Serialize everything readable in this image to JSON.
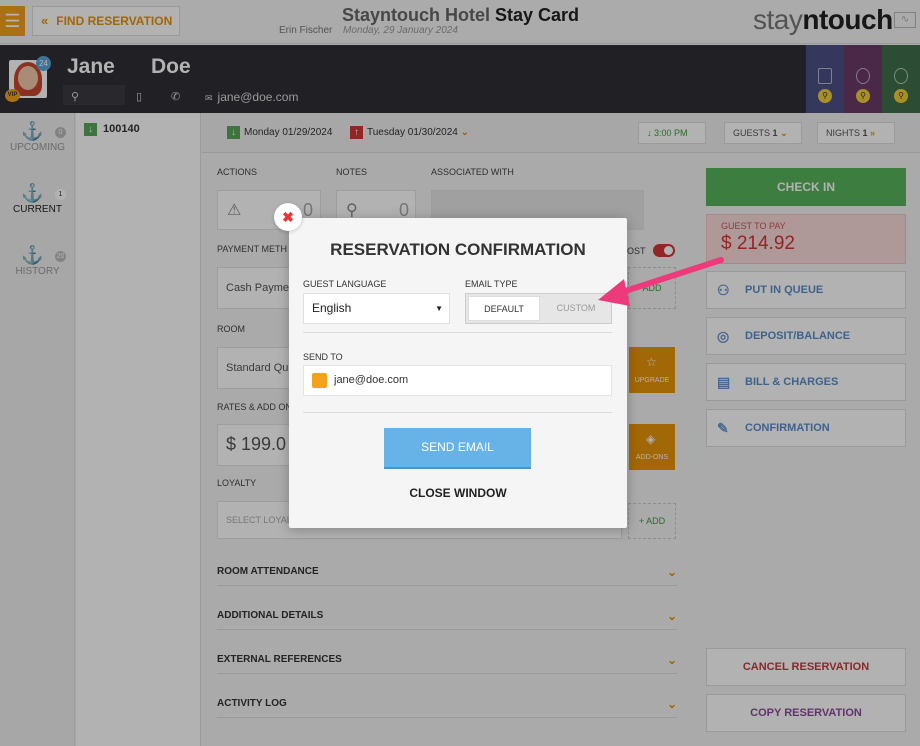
{
  "topbar": {
    "find_reservation": "FIND RESERVATION",
    "hotel_name": "Stayntouch Hotel",
    "page_title": "Stay Card",
    "user_name": "Erin Fischer",
    "business_date": "Monday, 29 January 2024",
    "logo_part1": "stay",
    "logo_part2": "n",
    "logo_part3": "touch"
  },
  "guest": {
    "first_name": "Jane",
    "last_name": "Doe",
    "email": "jane@doe.com",
    "avatar_badge": "24",
    "vip_label": "VIP",
    "tiles": [
      {
        "color": "#4c4f86"
      },
      {
        "color": "#693a68"
      },
      {
        "color": "#3f6f4a"
      }
    ]
  },
  "sidebar": {
    "items": [
      {
        "label": "UPCOMING",
        "count": "0"
      },
      {
        "label": "CURRENT",
        "count": "1"
      },
      {
        "label": "HISTORY",
        "count": "20"
      }
    ]
  },
  "reservation": {
    "number": "100140"
  },
  "staybar": {
    "arrival": "Monday 01/29/2024",
    "departure": "Tuesday 01/30/2024",
    "time": "3:00 PM",
    "guests_label": "GUESTS",
    "guests_value": "1",
    "nights_label": "NIGHTS",
    "nights_value": "1"
  },
  "main": {
    "actions_label": "ACTIONS",
    "actions_count": "0",
    "notes_label": "NOTES",
    "notes_count": "0",
    "associated_label": "ASSOCIATED WITH",
    "payment_label": "PAYMENT METH",
    "payment_value": "Cash Payme",
    "post_label": "OST",
    "add_label": "ADD",
    "room_label": "ROOM",
    "room_value": "Standard Qu",
    "upgrade_label": "UPGRADE",
    "rates_label": "RATES & ADD ON",
    "rate_value": "$ 199.0",
    "addons_label": "ADD-ONS",
    "loyalty_label": "LOYALTY",
    "loyalty_placeholder": "SELECT LOYAL",
    "loyalty_add": "+ ADD",
    "sections": [
      "ROOM ATTENDANCE",
      "ADDITIONAL DETAILS",
      "EXTERNAL REFERENCES",
      "ACTIVITY LOG"
    ]
  },
  "right": {
    "check_in": "CHECK IN",
    "guest_to_pay_label": "GUEST TO PAY",
    "guest_to_pay_amount": "$ 214.92",
    "buttons": [
      "PUT IN QUEUE",
      "DEPOSIT/BALANCE",
      "BILL & CHARGES",
      "CONFIRMATION"
    ],
    "cancel": "CANCEL RESERVATION",
    "copy": "COPY RESERVATION",
    "cancel_color": "#c33b3b",
    "copy_color": "#8b4a9c"
  },
  "modal": {
    "title": "RESERVATION CONFIRMATION",
    "guest_language_label": "GUEST LANGUAGE",
    "guest_language_value": "English",
    "email_type_label": "EMAIL TYPE",
    "email_type_options": [
      "DEFAULT",
      "CUSTOM"
    ],
    "email_type_selected": "DEFAULT",
    "send_to_label": "SEND TO",
    "send_to_value": "jane@doe.com",
    "send_email": "SEND EMAIL",
    "close_window": "CLOSE WINDOW",
    "close_icon": "close-icon"
  },
  "annotation": {
    "arrow_color": "#ee3a7a"
  }
}
